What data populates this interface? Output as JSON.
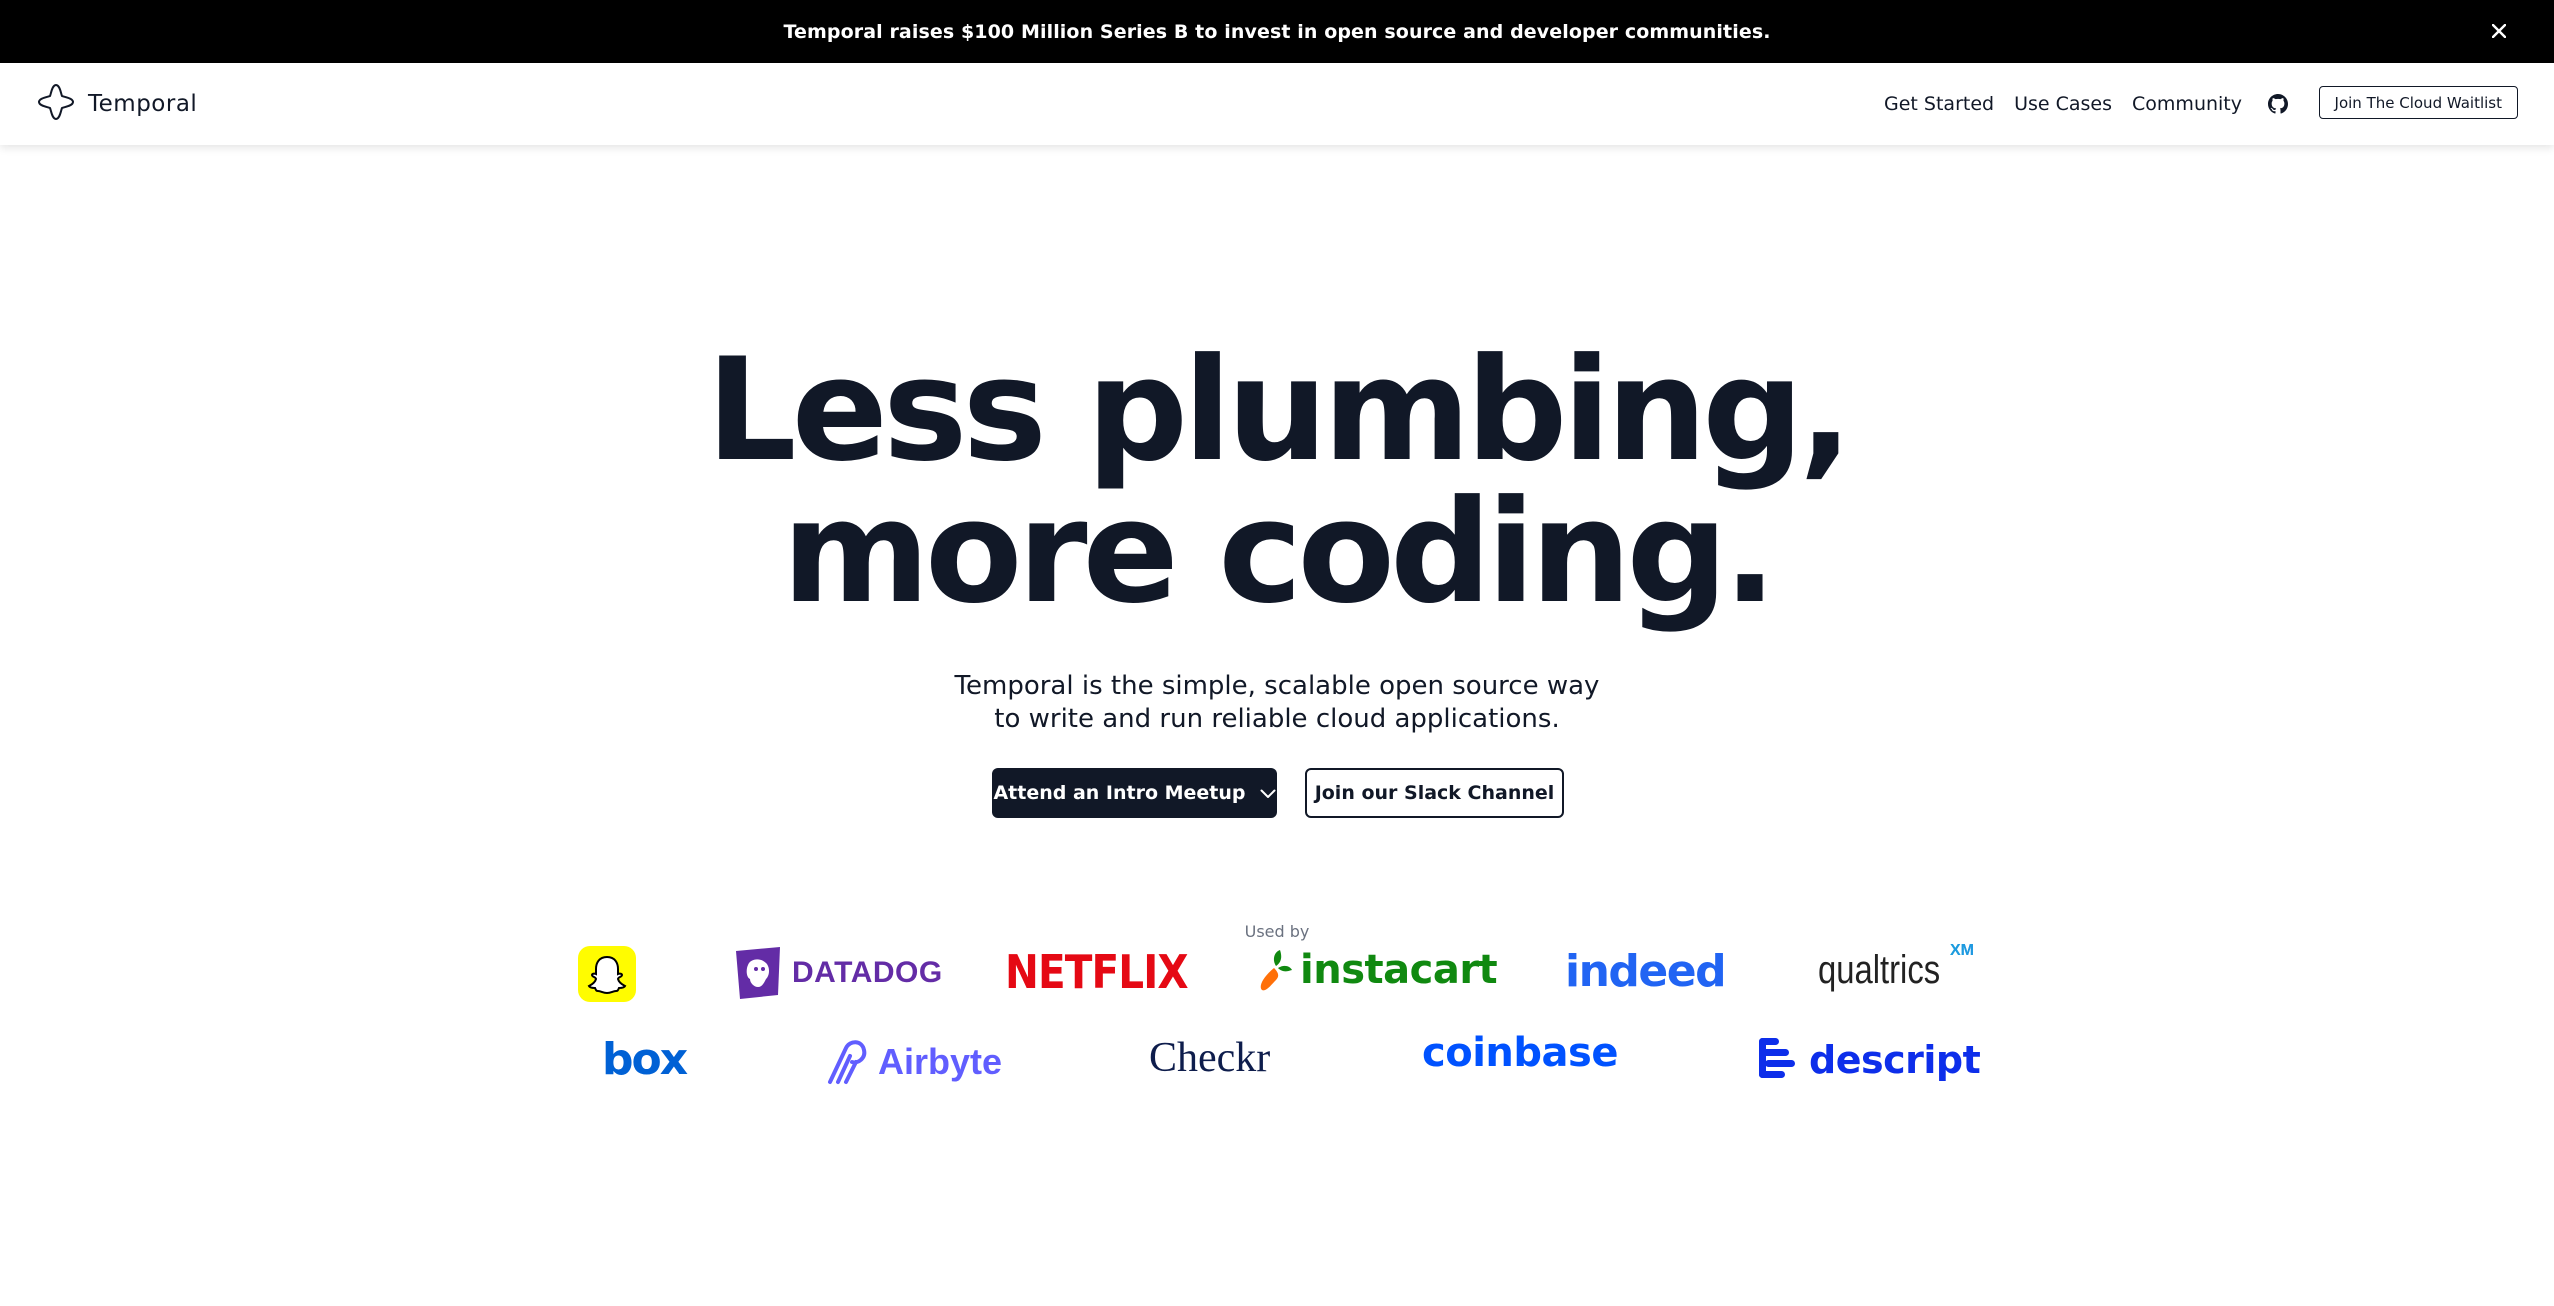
{
  "announcement": {
    "text": "Temporal raises $100 Million Series B to invest in open source and developer communities.",
    "close_icon": "close-icon"
  },
  "header": {
    "brand_name": "Temporal",
    "logo_icon": "temporal-logo-icon",
    "nav": [
      "Get Started",
      "Use Cases",
      "Community"
    ],
    "github_icon": "github-icon",
    "waitlist_label": "Join The Cloud Waitlist"
  },
  "hero": {
    "title_line1": "Less plumbing,",
    "title_line2": "more coding.",
    "subtitle_line1": "Temporal is the simple, scalable open source way",
    "subtitle_line2": "to write and run reliable cloud applications.",
    "primary_cta": "Attend an Intro Meetup",
    "secondary_cta": "Join our Slack Channel"
  },
  "customers": {
    "label": "Used by",
    "row1": [
      "snapchat",
      "DATADOG",
      "NETFLIX",
      "instacart",
      "indeed",
      "qualtrics",
      "XM"
    ],
    "row2": [
      "box",
      "Airbyte",
      "Checkr",
      "coinbase",
      "descript"
    ]
  },
  "colors": {
    "dark": "#111827",
    "netflix": "#E50914",
    "datadog": "#632CA6",
    "instacart": "#108910",
    "indeed": "#2164F3",
    "box": "#0061D5",
    "airbyte": "#615EFF",
    "checkr": "#0E1D4C",
    "coinbase": "#0052FF",
    "descript": "#0D2EEA",
    "snapchat": "#FFFC00"
  }
}
